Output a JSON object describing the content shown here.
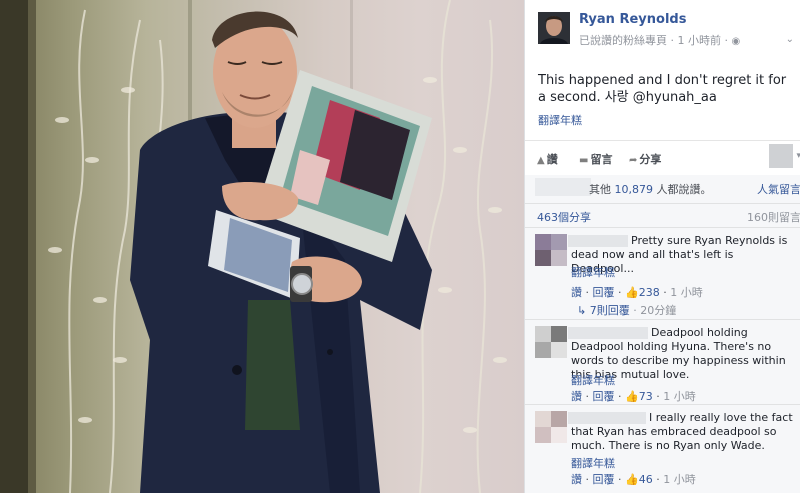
{
  "post": {
    "poster_name": "Ryan Reynolds",
    "page_status": "已說讚的粉絲專頁",
    "timestamp": "1 小時前",
    "privacy_icon": "globe-icon",
    "text": "This happened and I don't regret it for a second. 사랑 @hyunah_aa",
    "see_translation": "翻譯年糕"
  },
  "actions": {
    "like": "讚",
    "comment": "留言",
    "share": "分享"
  },
  "reactions": {
    "others_label": "其他",
    "like_count": "10,879",
    "people_liked": "人都說讚。",
    "top_comments": "人氣留言"
  },
  "counts": {
    "shares": "463個分享",
    "comments": "160則留言"
  },
  "comments": [
    {
      "text": "Pretty sure Ryan Reynolds is dead now and all that's left is Deadpool...",
      "see_translation": "翻譯年糕",
      "like": "讚",
      "reply": "回覆",
      "likes": "238",
      "time": "1 小時",
      "replies": "7則回覆",
      "reply_time": "20分鐘"
    },
    {
      "text": "Deadpool holding Deadpool holding Hyuna. There's no words to describe my happiness within this bias mutual love.",
      "see_translation": "翻譯年糕",
      "like": "讚",
      "reply": "回覆",
      "likes": "73",
      "time": "1 小時"
    },
    {
      "text": "I really really love the fact that Ryan has embraced deadpool so much. There is no Ryan only Wade.",
      "see_translation": "翻譯年糕",
      "like": "讚",
      "reply": "回覆",
      "likes": "46",
      "time": "1 小時"
    }
  ],
  "colors": {
    "link": "#365899",
    "panel_bg": "#f6f7f9",
    "text": "#1d2129",
    "muted": "#90949c"
  }
}
